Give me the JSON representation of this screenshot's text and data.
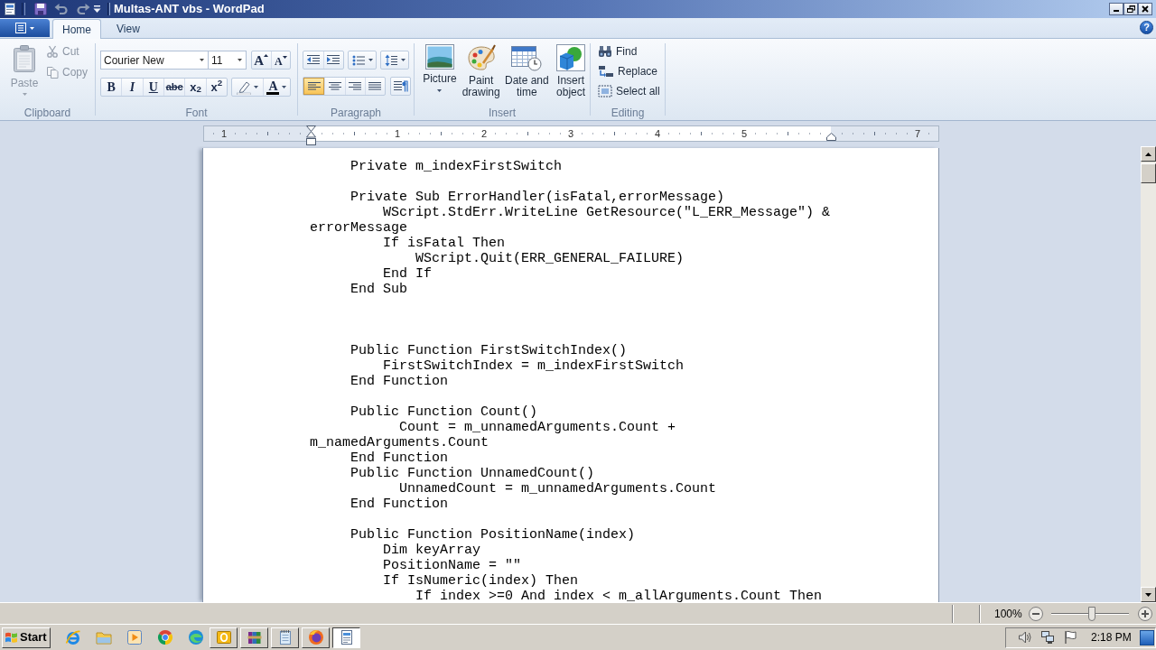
{
  "window": {
    "title": "Multas-ANT vbs - WordPad"
  },
  "quick_access": [
    {
      "kind": "save",
      "disabled": false
    },
    {
      "kind": "undo",
      "disabled": true
    },
    {
      "kind": "redo",
      "disabled": true
    },
    {
      "kind": "customize",
      "disabled": false
    }
  ],
  "tabs": [
    {
      "label": "Home",
      "selected": true
    },
    {
      "label": "View",
      "selected": false
    }
  ],
  "help_button": {
    "label": "?"
  },
  "ribbon": {
    "clipboard": {
      "label": "Clipboard",
      "paste": {
        "label": "Paste",
        "disabled": true
      },
      "items": [
        {
          "kind": "cut",
          "label": "Cut",
          "disabled": true
        },
        {
          "kind": "copy",
          "label": "Copy",
          "disabled": true
        }
      ]
    },
    "font": {
      "label": "Font",
      "family": "Courier New",
      "size": "11",
      "size_buttons": [
        {
          "kind": "grow",
          "glyph": "A"
        },
        {
          "kind": "shrink",
          "glyph": "A"
        }
      ],
      "styles": [
        {
          "kind": "bold",
          "glyph": "B"
        },
        {
          "kind": "italic",
          "glyph": "I"
        },
        {
          "kind": "underline",
          "glyph": "U"
        },
        {
          "kind": "strikethrough",
          "glyph": "abc"
        },
        {
          "kind": "subscript",
          "glyph": "x$_{2}$"
        },
        {
          "kind": "superscript",
          "glyph": "x$^{2}$"
        }
      ],
      "font_color": {
        "glyph": "A"
      }
    },
    "paragraph": {
      "label": "Paragraph",
      "tools": [
        {
          "kind": "outdent"
        },
        {
          "kind": "indent"
        },
        {
          "kind": "bullets"
        },
        {
          "kind": "line_spacing"
        }
      ],
      "alignment": [
        {
          "kind": "left",
          "selected": true
        },
        {
          "kind": "center",
          "selected": false
        },
        {
          "kind": "right",
          "selected": false
        },
        {
          "kind": "justify",
          "selected": false
        }
      ]
    },
    "insert": {
      "label": "Insert",
      "items": [
        {
          "kind": "picture",
          "label": "Picture"
        },
        {
          "kind": "paint",
          "label": "Paint drawing"
        },
        {
          "kind": "datetime",
          "label": "Date and time"
        },
        {
          "kind": "object",
          "label": "Insert object"
        }
      ]
    },
    "editing": {
      "label": "Editing",
      "items": [
        {
          "kind": "find",
          "label": "Find"
        },
        {
          "kind": "replace",
          "label": "Replace"
        },
        {
          "kind": "select_all",
          "label": "Select all"
        }
      ]
    }
  },
  "ruler": {
    "marks": [
      {
        "kind": "number",
        "label": "1"
      },
      {
        "kind": "left_indent"
      },
      {
        "kind": "number",
        "label": "1"
      },
      {
        "kind": "number",
        "label": "2"
      },
      {
        "kind": "number",
        "label": "3"
      },
      {
        "kind": "number",
        "label": "4"
      },
      {
        "kind": "number",
        "label": "5"
      },
      {
        "kind": "right_indent"
      },
      {
        "kind": "number",
        "label": "7"
      }
    ]
  },
  "document": {
    "lines": [
      {
        "kind": "code",
        "text": "     Private m_indexFirstSwitch"
      },
      {
        "kind": "blank"
      },
      {
        "kind": "code",
        "text": "     Private Sub ErrorHandler(isFatal,errorMessage)"
      },
      {
        "kind": "code",
        "text": "         WScript.StdErr.WriteLine GetResource(\"L_ERR_Message\") &"
      },
      {
        "kind": "code",
        "text": "errorMessage"
      },
      {
        "kind": "code",
        "text": "         If isFatal Then"
      },
      {
        "kind": "code",
        "text": "             WScript.Quit(ERR_GENERAL_FAILURE)"
      },
      {
        "kind": "code",
        "text": "         End If"
      },
      {
        "kind": "code",
        "text": "     End Sub"
      },
      {
        "kind": "blank"
      },
      {
        "kind": "blank"
      },
      {
        "kind": "blank"
      },
      {
        "kind": "code",
        "text": "     Public Function FirstSwitchIndex()"
      },
      {
        "kind": "code",
        "text": "         FirstSwitchIndex = m_indexFirstSwitch"
      },
      {
        "kind": "code",
        "text": "     End Function"
      },
      {
        "kind": "blank"
      },
      {
        "kind": "code",
        "text": "     Public Function Count()"
      },
      {
        "kind": "code",
        "text": "           Count = m_unnamedArguments.Count +"
      },
      {
        "kind": "code",
        "text": "m_namedArguments.Count"
      },
      {
        "kind": "code",
        "text": "     End Function"
      },
      {
        "kind": "code",
        "text": "     Public Function UnnamedCount()"
      },
      {
        "kind": "code",
        "text": "           UnnamedCount = m_unnamedArguments.Count"
      },
      {
        "kind": "code",
        "text": "     End Function"
      },
      {
        "kind": "blank"
      },
      {
        "kind": "code",
        "text": "     Public Function PositionName(index)"
      },
      {
        "kind": "code",
        "text": "         Dim keyArray"
      },
      {
        "kind": "code",
        "text": "         PositionName = \"\""
      },
      {
        "kind": "code",
        "text": "         If IsNumeric(index) Then"
      },
      {
        "kind": "code",
        "text": "             If index >=0 And index < m_allArguments.Count Then"
      }
    ]
  },
  "status_bar": {
    "zoom": {
      "reading": "100%",
      "level": 0.52
    }
  },
  "taskbar": {
    "start": "Start",
    "quick_launch": [
      {
        "kind": "ring_swoosh"
      },
      {
        "kind": "folder"
      },
      {
        "kind": "play"
      },
      {
        "kind": "tricolor"
      },
      {
        "kind": "swirl"
      }
    ],
    "windows": [
      {
        "kind": "ring_tile",
        "selected": false
      },
      {
        "kind": "books",
        "selected": false
      },
      {
        "kind": "notepad",
        "selected": false
      },
      {
        "kind": "flame",
        "selected": false
      },
      {
        "kind": "document",
        "selected": true
      }
    ],
    "tray": [
      {
        "kind": "speaker"
      },
      {
        "kind": "network"
      },
      {
        "kind": "flag"
      }
    ],
    "clock": "2:18 PM"
  }
}
